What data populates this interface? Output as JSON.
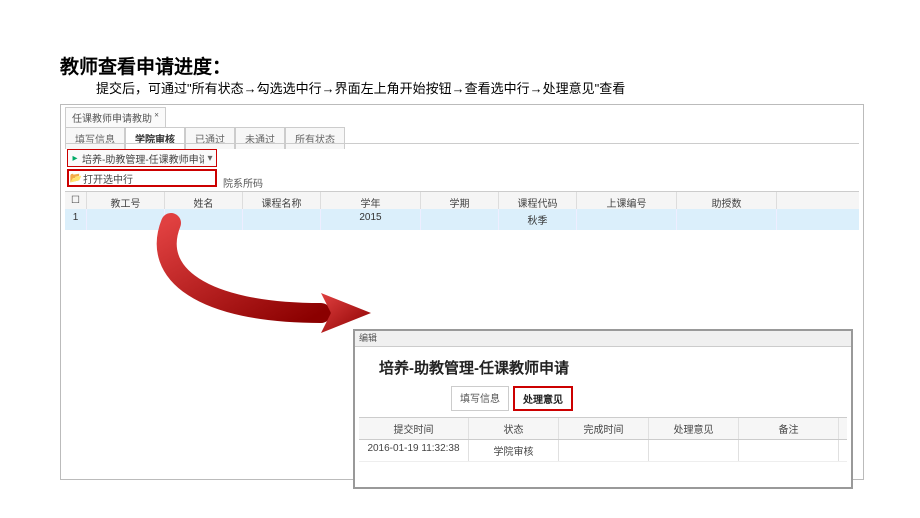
{
  "page": {
    "title": "教师查看申请进度：",
    "subtitle": "提交后，可通过\"所有状态→勾选选中行→界面左上角开始按钮→查看选中行→处理意见\"查看"
  },
  "window_tab": "任课教师申请教助",
  "main_tabs": [
    "填写信息",
    "学院审核",
    "已通过",
    "未通过",
    "所有状态"
  ],
  "main_tabs_active": 1,
  "combo_label": "培养-助教管理-任课教师申请",
  "open_btn": "打开选中行",
  "col_label": "院系所码",
  "grid_headers": [
    "",
    "教工号",
    "姓名",
    "课程名称",
    "学年",
    "学期",
    "课程代码",
    "上课编号",
    "助授数"
  ],
  "grid_row": {
    "idx": "1",
    "c4": "2015",
    "c6": "秋季"
  },
  "popup": {
    "header": "编辑",
    "title": "培养-助教管理-任课教师申请",
    "tabs": [
      "填写信息",
      "处理意见"
    ],
    "tabs_active": 1,
    "headers": [
      "提交时间",
      "状态",
      "完成时间",
      "处理意见",
      "备注"
    ],
    "row": {
      "time": "2016-01-19 11:32:38",
      "status": "学院审核"
    }
  }
}
